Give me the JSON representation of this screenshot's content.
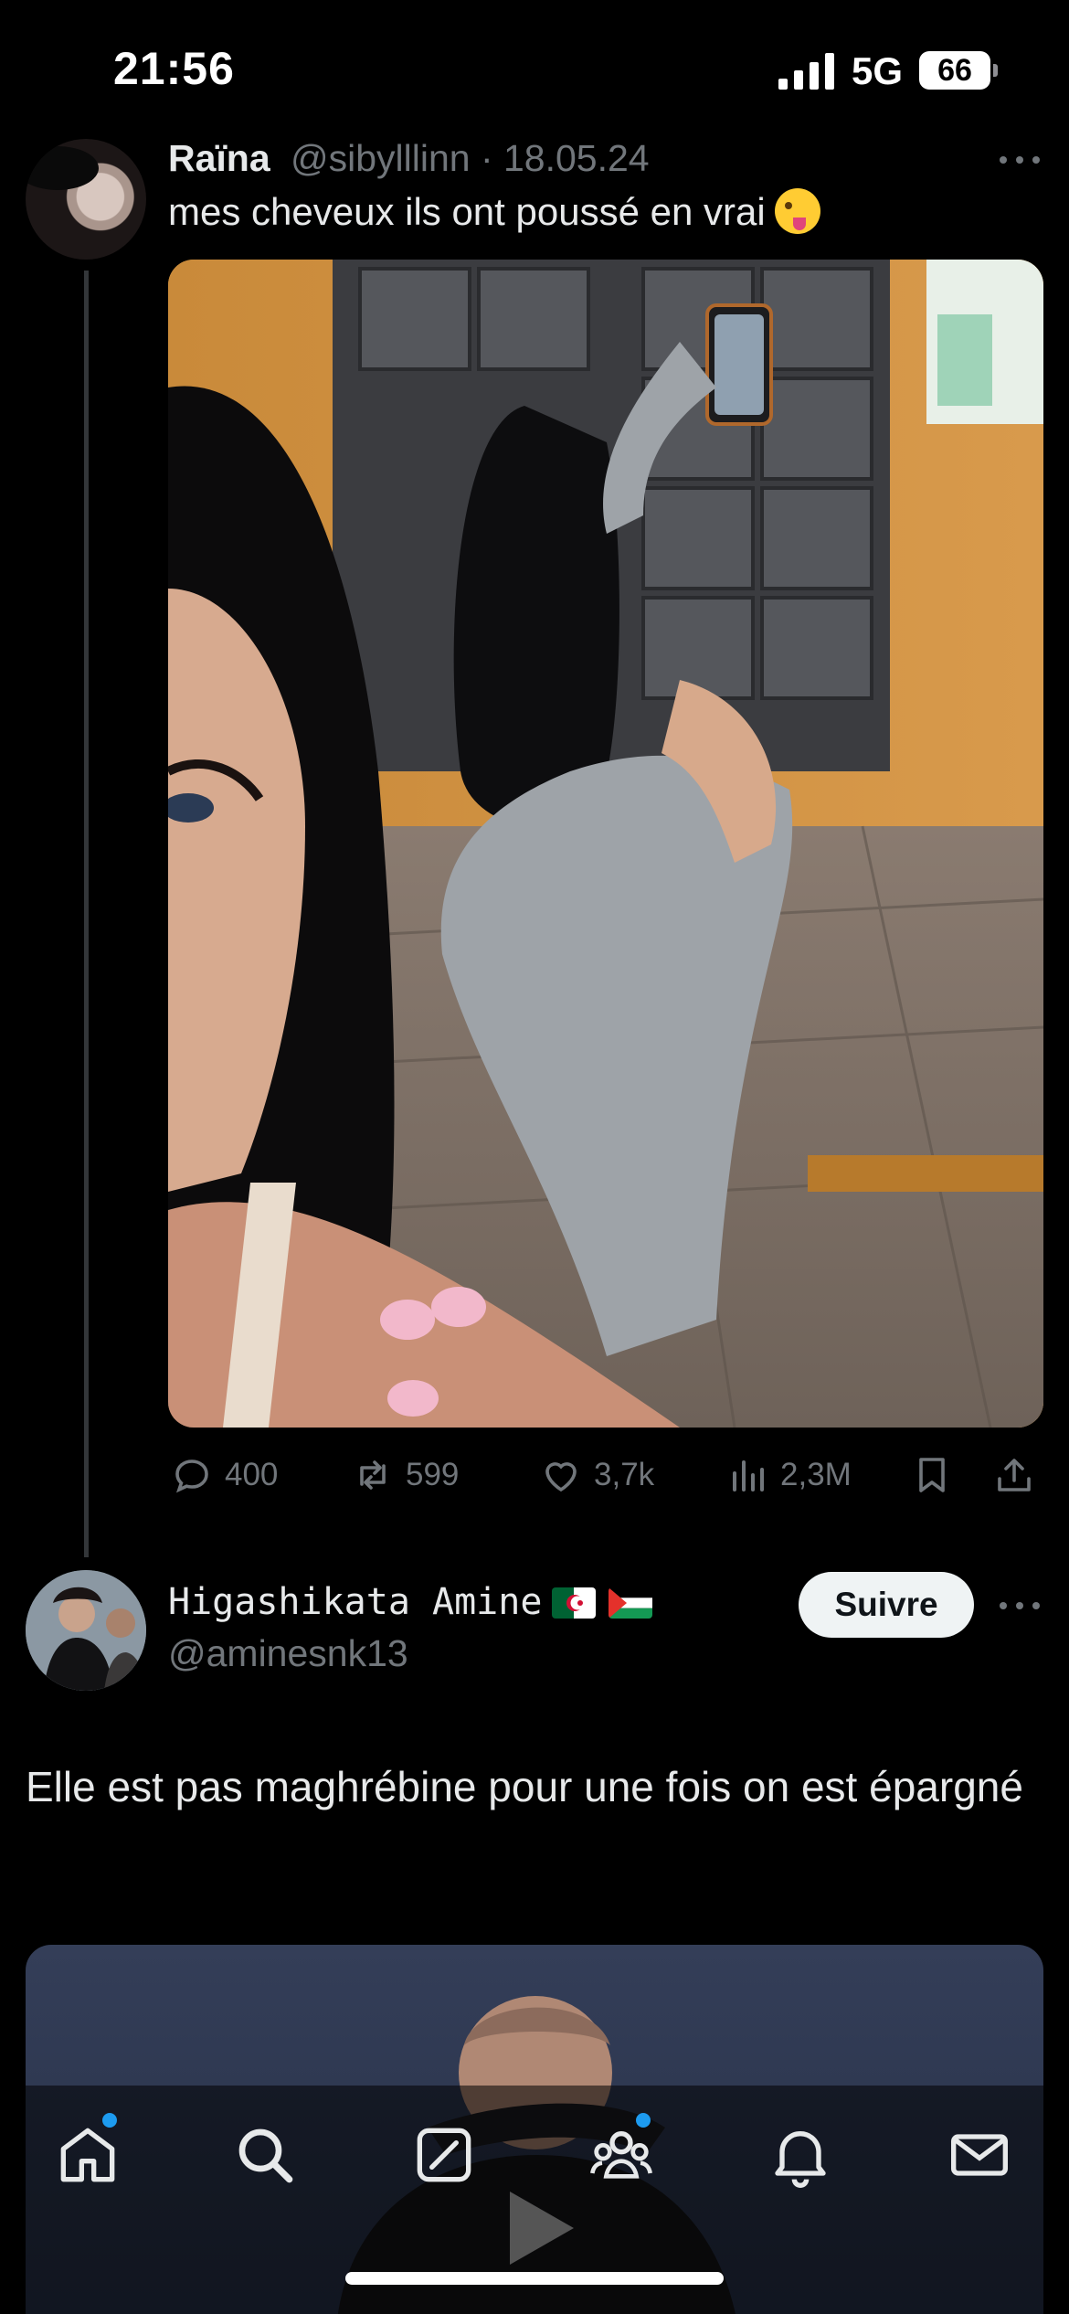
{
  "status_bar": {
    "time": "21:56",
    "network": "5G",
    "battery": "66"
  },
  "tweet": {
    "author_name": "Raïna",
    "author_handle_date": "@sibylllinn · 18.05.24",
    "text": "mes cheveux ils ont poussé en vrai",
    "emoji": "winking-face-with-tongue",
    "stats": {
      "replies": "400",
      "reposts": "599",
      "likes": "3,7k",
      "views": "2,3M"
    }
  },
  "reply": {
    "author_name": "Higashikata Amine",
    "author_flags": [
      "algeria-flag",
      "palestine-flag"
    ],
    "author_handle": "@aminesnk13",
    "follow_label": "Suivre",
    "text": "Elle est pas maghrébine pour une fois on est épargné"
  },
  "tab_bar": {
    "items": [
      "home-icon",
      "search-icon",
      "grok-icon",
      "communities-icon",
      "notifications-icon",
      "messages-icon"
    ],
    "accent": "#1d9bf0"
  },
  "colors": {
    "background": "#000000",
    "text": "#e7e9ea",
    "secondary": "#71767b",
    "accent": "#1d9bf0"
  }
}
